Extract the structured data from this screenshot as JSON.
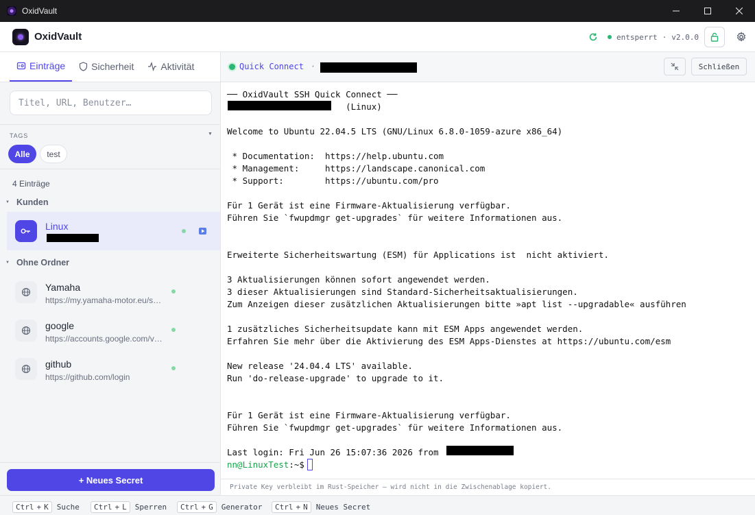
{
  "window": {
    "title": "OxidVault"
  },
  "header": {
    "app_name": "OxidVault",
    "status": "entsperrt",
    "separator": "·",
    "version": "v2.0.0"
  },
  "sidebar": {
    "tabs": [
      {
        "label": "Einträge",
        "icon": "vault-icon"
      },
      {
        "label": "Sicherheit",
        "icon": "shield-icon"
      },
      {
        "label": "Aktivität",
        "icon": "activity-icon"
      }
    ],
    "search": {
      "placeholder": "Titel, URL, Benutzer…",
      "value": ""
    },
    "tags_label": "TAGS",
    "tags": [
      "Alle",
      "test"
    ],
    "count": "4 Einträge",
    "folders": [
      {
        "name": "Kunden",
        "entries": [
          {
            "title": "Linux",
            "subtitle": "",
            "type": "ssh-key",
            "selected": true
          }
        ]
      },
      {
        "name": "Ohne Ordner",
        "entries": [
          {
            "title": "Yamaha",
            "subtitle": "https://my.yamaha-motor.eu/s…",
            "type": "web"
          },
          {
            "title": "google",
            "subtitle": "https://accounts.google.com/v…",
            "type": "web"
          },
          {
            "title": "github",
            "subtitle": "https://github.com/login",
            "type": "web"
          }
        ]
      }
    ],
    "new_button": "+ Neues Secret"
  },
  "terminal": {
    "header_title": "Quick Connect",
    "header_sep": "·",
    "close_label": "Schließen",
    "lines": [
      "── OxidVault SSH Quick Connect ──",
      "                       (Linux)",
      "",
      "Welcome to Ubuntu 22.04.5 LTS (GNU/Linux 6.8.0-1059-azure x86_64)",
      "",
      " * Documentation:  https://help.ubuntu.com",
      " * Management:     https://landscape.canonical.com",
      " * Support:        https://ubuntu.com/pro",
      "",
      "Für 1 Gerät ist eine Firmware-Aktualisierung verfügbar.",
      "Führen Sie `fwupdmgr get-upgrades` für weitere Informationen aus.",
      "",
      "",
      "Erweiterte Sicherheitswartung (ESM) für Applications ist  nicht aktiviert.",
      "",
      "3 Aktualisierungen können sofort angewendet werden.",
      "3 dieser Aktualisierungen sind Standard-Sicherheitsaktualisierungen.",
      "Zum Anzeigen dieser zusätzlichen Aktualisierungen bitte »apt list --upgradable« ausführen",
      "",
      "1 zusätzliches Sicherheitsupdate kann mit ESM Apps angewendet werden.",
      "Erfahren Sie mehr über die Aktivierung des ESM Apps-Dienstes at https://ubuntu.com/esm",
      "",
      "New release '24.04.4 LTS' available.",
      "Run 'do-release-upgrade' to upgrade to it.",
      "",
      "",
      "Für 1 Gerät ist eine Firmware-Aktualisierung verfügbar.",
      "Führen Sie `fwupdmgr get-upgrades` für weitere Informationen aus.",
      "",
      "Last login: Fri Jun 26 15:07:36 2026 from"
    ],
    "prompt_user": "nn@LinuxTest",
    "prompt_path": ":~$",
    "footer": "Private Key verbleibt im Rust-Speicher — wird nicht in die Zwischenablage kopiert."
  },
  "shortcuts": [
    {
      "keys": [
        "Ctrl",
        "+",
        "K"
      ],
      "label": "Suche"
    },
    {
      "keys": [
        "Ctrl",
        "+",
        "L"
      ],
      "label": "Sperren"
    },
    {
      "keys": [
        "Ctrl",
        "+",
        "G"
      ],
      "label": "Generator"
    },
    {
      "keys": [
        "Ctrl",
        "+",
        "N"
      ],
      "label": "Neues Secret"
    }
  ],
  "colors": {
    "accent": "#4f46e5",
    "online": "#2bb673",
    "prompt": "#17a34a"
  }
}
